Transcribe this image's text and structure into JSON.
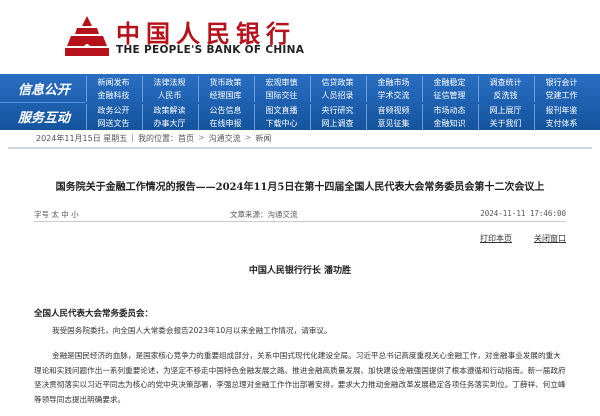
{
  "header": {
    "logo_cn": "中国人民银行",
    "logo_en": "THE PEOPLE'S BANK OF CHINA"
  },
  "nav": {
    "group1": "信息公开",
    "group2": "服务互动",
    "row1": [
      "新闻发布",
      "法律法规",
      "货币政策",
      "宏观审慎",
      "信贷政策",
      "金融市场",
      "金融稳定",
      "调查统计",
      "银行会计",
      "金融科技",
      "人民币",
      "经理国库",
      "国际交往",
      "人员招录",
      "学术交流",
      "征信管理",
      "反洗钱",
      "党建工作"
    ],
    "row2": [
      "政务公开",
      "政策解读",
      "公告信息",
      "图文直播",
      "央行研究",
      "音频视频",
      "市场动态",
      "网上展厅",
      "报刊年鉴",
      "网送文告",
      "办事大厅",
      "在线申报",
      "下载中心",
      "网上调查",
      "意见征集",
      "金融知识",
      "关于我们",
      ""
    ],
    "extra": [
      "支付体系"
    ]
  },
  "breadcrumb": [
    "2024年11月15日 星期五",
    "我的位置：首页",
    "沟通交流",
    "新闻"
  ],
  "article": {
    "title": "国务院关于金融工作情况的报告——2024年11月5日在第十四届全国人民代表大会常务委员会第十二次会议上",
    "font_size_label": "字号 太 中 小",
    "source": "文章来源：沟通交流",
    "date": "2024-11-11 17:46:00",
    "print": "打印本页",
    "close": "关闭窗口",
    "author": "中国人民银行行长  潘功胜",
    "salutation": "全国人民代表大会常务委员会：",
    "p1": "我受国务院委托，向全国人大常委会报告2023年10月以来金融工作情况，请审议。",
    "p2": "金融是国民经济的血脉，是国家核心竞争力的重要组成部分，关系中国式现代化建设全局。习近平总书记高度重视关心金融工作，对金融事业发展的重大理论和实践问题作出一系列重要论述，为坚定不移走中国特色金融发展之路、推进金融高质量发展、加快建设金融强国提供了根本遵循和行动指南。新一届政府坚决贯彻落实以习近平同志为核心的党中央决策部署，李强总理对金融工作作出部署安排，要求大力推动金融改革发展稳定各项任务落实到位。丁薛祥、何立峰等领导同志提出明确要求。"
  }
}
